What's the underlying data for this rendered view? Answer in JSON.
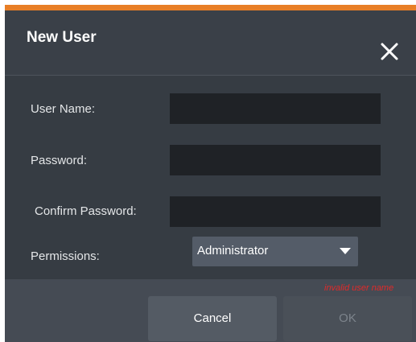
{
  "dialog": {
    "title": "New User",
    "close_icon": "close-icon",
    "accent_color": "#e87e26"
  },
  "form": {
    "username": {
      "label": "User Name:",
      "value": ""
    },
    "password": {
      "label": "Password:",
      "value": ""
    },
    "confirm_password": {
      "label": "Confirm Password:",
      "value": ""
    },
    "permissions": {
      "label": "Permissions:",
      "selected": "Administrator",
      "arrow_icon": "dropdown-arrow-icon"
    }
  },
  "footer": {
    "error": "invalid user name",
    "error_color": "#e02a2a",
    "cancel_label": "Cancel",
    "ok_label": "OK"
  }
}
